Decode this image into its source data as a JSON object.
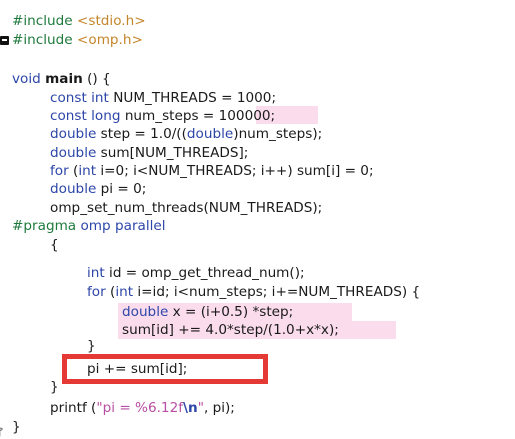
{
  "editor": {
    "language": "C (OpenMP)",
    "colors": {
      "preprocessor": "#1f7a3c",
      "include_file": "#c5862b",
      "keyword": "#2d46a8",
      "string": "#b94fa3",
      "text": "#1a1a1a",
      "line_highlight": "#fadcec",
      "annotation_box": "#e53935"
    },
    "gutter_icons": [
      "terminal-icon",
      "code-glyph-icon"
    ],
    "code": {
      "l1": {
        "pp": "#include",
        "file": "<stdio.h>"
      },
      "l2": {
        "pp": "#include",
        "file": "<omp.h>"
      },
      "l3": {
        "type": "void",
        "name": "main",
        "rest": " () {"
      },
      "l4": {
        "kw1": "const",
        "kw2": "int",
        "rest": " NUM_THREADS = 1000;"
      },
      "l5": {
        "kw1": "const",
        "kw2": "long",
        "a": " num_steps = ",
        "num": "100000",
        "b": ";"
      },
      "l6": {
        "t1": "double",
        "a": " step = 1.0/((",
        "t2": "double",
        "b": ")num_steps);"
      },
      "l7": {
        "t1": "double",
        "rest": " sum[NUM_THREADS];"
      },
      "l8": {
        "k1": "for",
        "a": " (",
        "k2": "int",
        "b": " i=0; i<NUM_THREADS; i++) sum[i] = 0;"
      },
      "l9": {
        "t1": "double",
        "rest": " pi = 0;"
      },
      "l10": {
        "rest": "omp_set_num_threads(NUM_THREADS);"
      },
      "l11": {
        "pp": "#pragma",
        "k1": "omp",
        "k2": "parallel"
      },
      "l12": {
        "rest": "{"
      },
      "l13": {
        "t1": "int",
        "rest": " id = omp_get_thread_num();"
      },
      "l14": {
        "k1": "for",
        "a": " (",
        "k2": "int",
        "b": " i=id; i<num_steps; i+=NUM_THREADS) {"
      },
      "l15": {
        "t1": "double",
        "rest": " x = (i+0.5) *step;"
      },
      "l16": {
        "rest": "sum[id] += 4.0*step/(1.0+x*x);"
      },
      "l17": {
        "rest": "}"
      },
      "l18": {
        "rest": "pi += sum[id];"
      },
      "l19": {
        "rest": "}"
      },
      "l20": {
        "fn": "printf",
        "a": " (",
        "s1": "\"pi = %6.12f",
        "esc": "\\n",
        "s2": "\"",
        "b": ", pi);"
      },
      "l21": {
        "rest": "}"
      }
    }
  }
}
